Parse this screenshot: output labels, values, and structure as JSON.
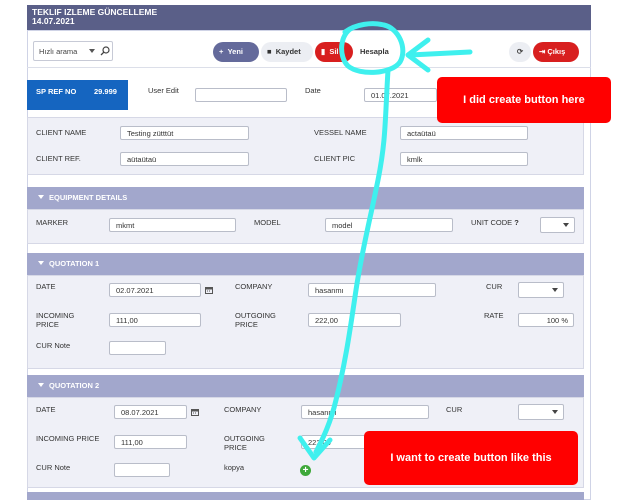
{
  "window": {
    "title": "TEKLIF IZLEME GÜNCELLEME",
    "date": "14.07.2021"
  },
  "toolbar": {
    "search_placeholder": "Hızlı arama",
    "new_label": "Yeni",
    "save_label": "Kaydet",
    "delete_label": "Sil",
    "calc_label": "Hesapla",
    "exit_label": "Çıkış"
  },
  "header": {
    "ref_label": "SP REF NO",
    "ref_value": "29.999",
    "user_edit_label": "User Edit",
    "user_edit_value": "",
    "date_label": "Date",
    "date_value": "01.07.2021"
  },
  "client": {
    "client_name_label": "CLIENT NAME",
    "client_name_value": "Testing zütttüt",
    "vessel_name_label": "VESSEL NAME",
    "vessel_name_value": "actaütaü",
    "client_ref_label": "CLIENT REF.",
    "client_ref_value": "aütaütaü",
    "client_pic_label": "CLIENT PIC",
    "client_pic_value": "kmlk"
  },
  "equipment": {
    "title": "EQUIPMENT DETAILS",
    "marker_label": "MARKER",
    "marker_value": "mkmt",
    "model_label": "MODEL",
    "model_value": "model",
    "unit_code_label": "UNIT CODE",
    "unit_code_help": "?"
  },
  "quotation1": {
    "title": "QUOTATION 1",
    "date_label": "DATE",
    "date_value": "02.07.2021",
    "company_label": "COMPANY",
    "company_value": "hasanmı",
    "cur_label": "CUR",
    "incoming_label_1": "INCOMING",
    "incoming_label_2": "PRICE",
    "incoming_value": "111,00",
    "outgoing_label_1": "OUTGOING",
    "outgoing_label_2": "PRICE",
    "outgoing_value": "222,00",
    "rate_label": "RATE",
    "rate_value": "100 %",
    "cur_note_label": "CUR Note",
    "cur_note_value": ""
  },
  "quotation2": {
    "title": "QUOTATION 2",
    "date_label": "DATE",
    "date_value": "08.07.2021",
    "company_label": "COMPANY",
    "company_value": "hasanmı",
    "cur_label": "CUR",
    "incoming_label": "INCOMING PRICE",
    "incoming_value": "111,00",
    "outgoing_label_1": "OUTGOING",
    "outgoing_label_2": "PRICE",
    "outgoing_value": "222,00",
    "cur_note_label": "CUR Note",
    "cur_note_value": "",
    "kopya_label": "kopya",
    "add_symbol": "+"
  },
  "annotations": {
    "callout_top": "I did create button here",
    "callout_bottom": "I want to create button like this",
    "callout_color": "#ff0000",
    "arrow_color": "#3ff0ee"
  },
  "colors": {
    "title_bar": "#5a5f88",
    "section_header": "#a2a7cc",
    "ref_box": "#1565c0",
    "danger": "#d81f1f",
    "primary": "#646a9b"
  }
}
